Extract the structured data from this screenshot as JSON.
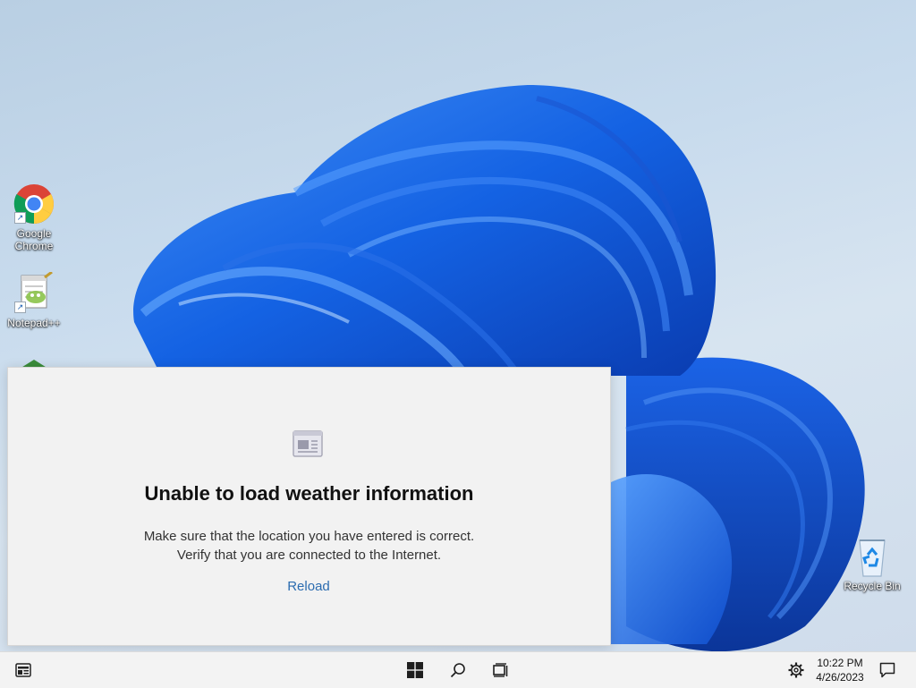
{
  "desktop": {
    "icons": [
      {
        "label_line1": "Google",
        "label_line2": "Chrome",
        "icon": "chrome-icon"
      },
      {
        "label_line1": "Notepad++",
        "label_line2": "",
        "icon": "notepadpp-icon"
      },
      {
        "label_line1": "Recycle Bin",
        "label_line2": "",
        "icon": "recycle-bin-icon"
      }
    ]
  },
  "weather": {
    "icon": "news-icon",
    "title": "Unable to load weather information",
    "message_line1": "Make sure that the location you have entered is correct.",
    "message_line2": "Verify that you are connected to the Internet.",
    "reload_label": "Reload"
  },
  "taskbar": {
    "widgets_icon": "widgets-icon",
    "start_icon": "windows-start-icon",
    "search_icon": "search-icon",
    "taskview_icon": "task-view-icon",
    "settings_icon": "gear-icon",
    "notification_icon": "notification-icon",
    "time": "10:22 PM",
    "date": "4/26/2023"
  },
  "colors": {
    "accent": "#2b6cb0",
    "wallpaper_bloom": "#1565e0",
    "taskbar": "#f3f3f3"
  }
}
